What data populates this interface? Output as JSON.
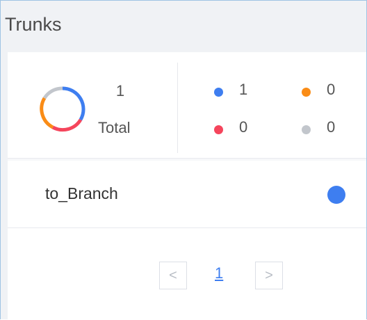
{
  "panel": {
    "title": "Trunks"
  },
  "summary": {
    "total_value": "1",
    "total_label": "Total",
    "stats": [
      {
        "name": "blue",
        "color": "#3e7ef0",
        "value": "1"
      },
      {
        "name": "orange",
        "color": "#fa8c16",
        "value": "0"
      },
      {
        "name": "red",
        "color": "#f5455c",
        "value": "0"
      },
      {
        "name": "gray",
        "color": "#c2c6cc",
        "value": "0"
      }
    ],
    "donut_colors": [
      "#f5455c",
      "#fa8c16",
      "#c2c6cc",
      "#3e7ef0"
    ]
  },
  "trunks": [
    {
      "name": "to_Branch",
      "status_color": "#3e7ef0"
    }
  ],
  "pagination": {
    "prev": "<",
    "current": "1",
    "next": ">"
  }
}
